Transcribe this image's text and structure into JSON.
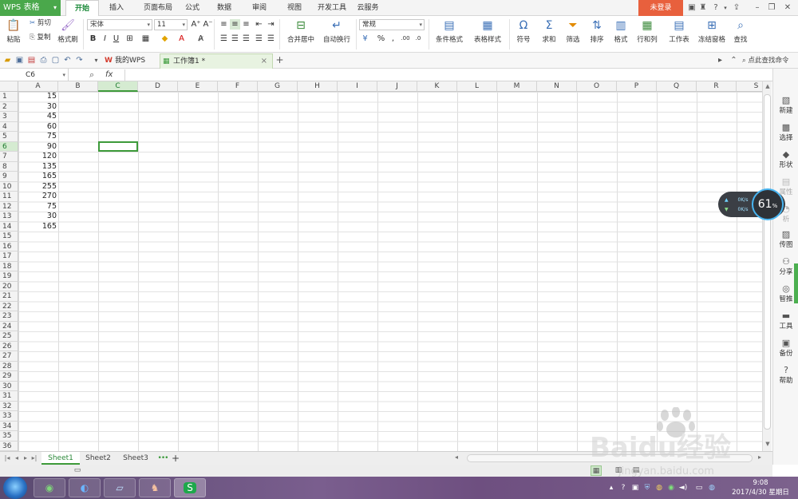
{
  "app": {
    "menu_label": "WPS 表格",
    "login_label": "未登录"
  },
  "ribbon_tabs": [
    "开始",
    "插入",
    "页面布局",
    "公式",
    "数据",
    "审阅",
    "视图",
    "开发工具",
    "云服务"
  ],
  "active_ribbon_tab": 0,
  "ribbon": {
    "paste": "粘贴",
    "cut": "剪切",
    "copy": "复制",
    "format_painter": "格式刷",
    "font_name": "宋体",
    "font_size": "11",
    "bold": "B",
    "italic": "I",
    "underline": "U",
    "merge_center": "合并居中",
    "auto_wrap": "自动换行",
    "number_format": "常规",
    "percent": "%",
    "thousands": ",",
    "increase_decimal": ".00",
    "decrease_decimal": ".0",
    "conditional_format": "条件格式",
    "table_style": "表格样式",
    "symbol": "符号",
    "sum": "求和",
    "filter": "筛选",
    "sort": "排序",
    "format": "格式",
    "row_col": "行和列",
    "worksheet": "工作表",
    "freeze": "冻结窗格",
    "find": "查找",
    "command_search": "点此查找命令"
  },
  "doc_tabs": [
    {
      "label": "我的WPS"
    },
    {
      "label": "工作簿1 *"
    }
  ],
  "formula_bar": {
    "cell_ref": "C6",
    "fx": "fx",
    "content": ""
  },
  "columns": [
    "A",
    "B",
    "C",
    "D",
    "E",
    "F",
    "G",
    "H",
    "I",
    "J",
    "K",
    "L",
    "M",
    "N",
    "O",
    "P",
    "Q",
    "R",
    "S"
  ],
  "selected_column": "C",
  "rows": [
    "1",
    "2",
    "3",
    "4",
    "5",
    "6",
    "7",
    "8",
    "9",
    "10",
    "11",
    "12",
    "13",
    "14",
    "15",
    "16",
    "17",
    "18",
    "19",
    "20",
    "21",
    "22",
    "23",
    "24",
    "25",
    "26",
    "27",
    "28",
    "29",
    "30",
    "31",
    "32",
    "33",
    "34",
    "35",
    "36"
  ],
  "selected_row": "6",
  "column_a_values": [
    "15",
    "30",
    "45",
    "60",
    "75",
    "90",
    "120",
    "135",
    "165",
    "255",
    "270",
    "75",
    "30",
    "165"
  ],
  "side_panel": [
    {
      "label": "新建",
      "icon": "new-icon"
    },
    {
      "label": "选择",
      "icon": "select-icon"
    },
    {
      "label": "形状",
      "icon": "shape-icon"
    },
    {
      "label": "属性",
      "icon": "property-icon"
    },
    {
      "label": "析",
      "icon": "analysis-icon"
    },
    {
      "label": "传图",
      "icon": "upload-image-icon"
    },
    {
      "label": "分享",
      "icon": "share-icon"
    },
    {
      "label": "智推",
      "icon": "smart-push-icon"
    },
    {
      "label": "工具",
      "icon": "tools-icon"
    },
    {
      "label": "备份",
      "icon": "backup-icon"
    },
    {
      "label": "帮助",
      "icon": "help-icon"
    }
  ],
  "speed_widget": {
    "up": "0K/s",
    "down": "0K/s",
    "percent": "61",
    "percent_unit": "%"
  },
  "sheets": [
    "Sheet1",
    "Sheet2",
    "Sheet3"
  ],
  "active_sheet": 0,
  "add_sheet": "+",
  "taskbar": {
    "time": "9:08",
    "date": "2017/4/30 星期日"
  },
  "watermark": {
    "text": "Baidu经验",
    "url": "jingyan.baidu.com"
  },
  "colors": {
    "accent": "#4aa84b",
    "login": "#e8603d",
    "selection": "#3d9a3a"
  }
}
